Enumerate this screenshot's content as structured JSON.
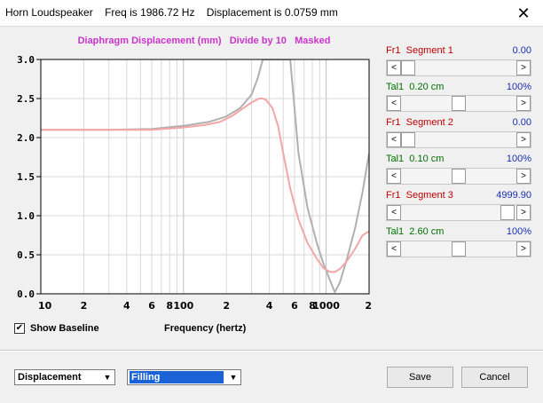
{
  "window": {
    "title": "Horn Loudspeaker    Freq is 1986.72 Hz    Displacement is 0.0759 mm",
    "close_glyph": "✕"
  },
  "plot": {
    "title": "Diaphragm Displacement (mm)   Divide by 10   Masked"
  },
  "chart_data": {
    "type": "line",
    "title": "Diaphragm Displacement (mm)   Divide by 10   Masked",
    "xlabel": "Frequency (hertz)",
    "ylabel": "",
    "xscale": "log",
    "xlim": [
      10,
      2000
    ],
    "ylim": [
      0,
      3.0
    ],
    "grid": true,
    "legend": "none",
    "x_tick_labels": [
      "10",
      "2",
      "4",
      "6",
      "8",
      "100",
      "2",
      "4",
      "6",
      "8",
      "1000",
      "2"
    ],
    "y_tick_labels": [
      "0.0",
      "0.5",
      "1.0",
      "1.5",
      "2.0",
      "2.5",
      "3.0"
    ],
    "series": [
      {
        "color": "#b0b0b0",
        "x": [
          10,
          30,
          60,
          100,
          150,
          200,
          250,
          300,
          330,
          360,
          400,
          420,
          480,
          560,
          640,
          740,
          860,
          960,
          1060,
          1150,
          1250,
          1400,
          1600,
          1800,
          2000
        ],
        "y": [
          2.1,
          2.1,
          2.11,
          2.15,
          2.2,
          2.27,
          2.38,
          2.55,
          2.75,
          3.0,
          3.0,
          3.0,
          3.0,
          3.0,
          1.8,
          1.1,
          0.65,
          0.38,
          0.18,
          0.02,
          0.15,
          0.45,
          0.85,
          1.3,
          1.8
        ]
      },
      {
        "color": "#f4a6a6",
        "x": [
          10,
          30,
          60,
          100,
          140,
          180,
          220,
          260,
          300,
          340,
          360,
          380,
          420,
          460,
          500,
          560,
          640,
          740,
          860,
          960,
          1060,
          1150,
          1250,
          1400,
          1600,
          1800,
          2000
        ],
        "y": [
          2.1,
          2.1,
          2.1,
          2.13,
          2.16,
          2.2,
          2.28,
          2.37,
          2.45,
          2.5,
          2.5,
          2.48,
          2.38,
          2.15,
          1.8,
          1.35,
          0.95,
          0.65,
          0.45,
          0.33,
          0.28,
          0.28,
          0.32,
          0.42,
          0.58,
          0.75,
          0.8
        ]
      }
    ]
  },
  "panel": {
    "seg1_label": "Fr1  Segment 1",
    "seg1_value": "0.00",
    "seg1_pos": 0.0,
    "tal1_label": "Tal1  0.20 cm",
    "tal1_value": "100%",
    "tal1_pos": 0.5,
    "seg2_label": "Fr1  Segment 2",
    "seg2_value": "0.00",
    "seg2_pos": 0.0,
    "tal2_label": "Tal1  0.10 cm",
    "tal2_value": "100%",
    "tal2_pos": 0.5,
    "seg3_label": "Fr1  Segment 3",
    "seg3_value": "4999.90",
    "seg3_pos": 0.98,
    "tal3_label": "Tal1  2.60 cm",
    "tal3_value": "100%",
    "tal3_pos": 0.5,
    "arrow_left": "<",
    "arrow_right": ">"
  },
  "baseline": {
    "label": "Show Baseline",
    "checked_glyph": "✔"
  },
  "selects": {
    "mode_value": "Displacement",
    "fill_value": "Filling",
    "arrow_glyph": "▼"
  },
  "buttons": {
    "save_label": "Save",
    "cancel_label": "Cancel"
  },
  "colors": {
    "title_magenta": "#cc33cc",
    "label_red": "#c00000",
    "label_green": "#007000",
    "value_blue": "#1a2faf",
    "select_highlight": "#1a62d6"
  }
}
